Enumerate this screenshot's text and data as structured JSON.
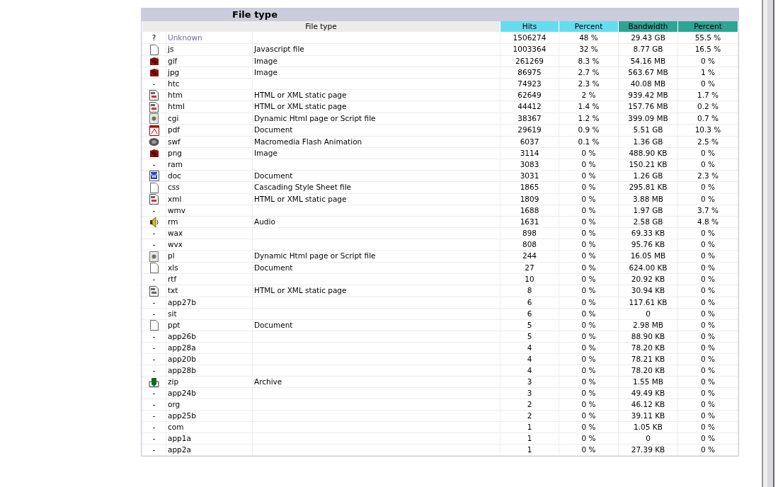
{
  "title": "File type",
  "table": {
    "columns": [
      {
        "label": "File type",
        "kind": "name"
      },
      {
        "label": "Hits",
        "kind": "hits"
      },
      {
        "label": "Percent",
        "kind": "hits"
      },
      {
        "label": "Bandwidth",
        "kind": "bandwidth"
      },
      {
        "label": "Percent",
        "kind": "bandwidth"
      }
    ],
    "rows": [
      {
        "kind": "unknown",
        "symbol": "?",
        "type": "Unknown",
        "hits": "1506274",
        "hits_pct": "48 %",
        "bandwidth": "29.43 GB",
        "bw_pct": "55.5 %"
      },
      {
        "kind": "page",
        "type": "js",
        "description": "Javascript file",
        "hits": "1003364",
        "hits_pct": "32 %",
        "bandwidth": "8.77 GB",
        "bw_pct": "16.5 %"
      },
      {
        "kind": "image",
        "type": "gif",
        "description": "Image",
        "hits": "261269",
        "hits_pct": "8.3 %",
        "bandwidth": "54.16 MB",
        "bw_pct": "0 %"
      },
      {
        "kind": "image",
        "type": "jpg",
        "description": "Image",
        "hits": "86975",
        "hits_pct": "2.7 %",
        "bandwidth": "563.67 MB",
        "bw_pct": "1 %"
      },
      {
        "kind": "none",
        "symbol": "-",
        "type": "htc",
        "hits": "74923",
        "hits_pct": "2.3 %",
        "bandwidth": "40.08 MB",
        "bw_pct": "0 %"
      },
      {
        "kind": "html",
        "type": "htm",
        "description": "HTML or XML static page",
        "hits": "62649",
        "hits_pct": "2 %",
        "bandwidth": "939.42 MB",
        "bw_pct": "1.7 %"
      },
      {
        "kind": "html",
        "type": "html",
        "description": "HTML or XML static page",
        "hits": "44412",
        "hits_pct": "1.4 %",
        "bandwidth": "157.76 MB",
        "bw_pct": "0.2 %"
      },
      {
        "kind": "script",
        "type": "cgi",
        "description": "Dynamic Html page or Script file",
        "hits": "38367",
        "hits_pct": "1.2 %",
        "bandwidth": "399.09 MB",
        "bw_pct": "0.7 %"
      },
      {
        "kind": "pdf",
        "type": "pdf",
        "description": "Document",
        "hits": "29619",
        "hits_pct": "0.9 %",
        "bandwidth": "5.51 GB",
        "bw_pct": "10.3 %"
      },
      {
        "kind": "flash",
        "type": "swf",
        "description": "Macromedia Flash Animation",
        "hits": "6037",
        "hits_pct": "0.1 %",
        "bandwidth": "1.36 GB",
        "bw_pct": "2.5 %"
      },
      {
        "kind": "image",
        "type": "png",
        "description": "Image",
        "hits": "3114",
        "hits_pct": "0 %",
        "bandwidth": "488.90 KB",
        "bw_pct": "0 %"
      },
      {
        "kind": "none",
        "symbol": "-",
        "type": "ram",
        "hits": "3083",
        "hits_pct": "0 %",
        "bandwidth": "150.21 KB",
        "bw_pct": "0 %"
      },
      {
        "kind": "word",
        "type": "doc",
        "description": "Document",
        "hits": "3031",
        "hits_pct": "0 %",
        "bandwidth": "1.26 GB",
        "bw_pct": "2.3 %"
      },
      {
        "kind": "page",
        "type": "css",
        "description": "Cascading Style Sheet file",
        "hits": "1865",
        "hits_pct": "0 %",
        "bandwidth": "295.81 KB",
        "bw_pct": "0 %"
      },
      {
        "kind": "html",
        "type": "xml",
        "description": "HTML or XML static page",
        "hits": "1809",
        "hits_pct": "0 %",
        "bandwidth": "3.88 MB",
        "bw_pct": "0 %"
      },
      {
        "kind": "none",
        "symbol": "-",
        "type": "wmv",
        "hits": "1688",
        "hits_pct": "0 %",
        "bandwidth": "1.97 GB",
        "bw_pct": "3.7 %"
      },
      {
        "kind": "audio",
        "type": "rm",
        "description": "Audio",
        "hits": "1631",
        "hits_pct": "0 %",
        "bandwidth": "2.58 GB",
        "bw_pct": "4.8 %"
      },
      {
        "kind": "none",
        "symbol": "-",
        "type": "wax",
        "hits": "898",
        "hits_pct": "0 %",
        "bandwidth": "69.33 KB",
        "bw_pct": "0 %"
      },
      {
        "kind": "none",
        "symbol": "-",
        "type": "wvx",
        "hits": "808",
        "hits_pct": "0 %",
        "bandwidth": "95.76 KB",
        "bw_pct": "0 %"
      },
      {
        "kind": "script",
        "type": "pl",
        "description": "Dynamic Html page or Script file",
        "hits": "244",
        "hits_pct": "0 %",
        "bandwidth": "16.05 MB",
        "bw_pct": "0 %"
      },
      {
        "kind": "page",
        "type": "xls",
        "description": "Document",
        "hits": "27",
        "hits_pct": "0 %",
        "bandwidth": "624.00 KB",
        "bw_pct": "0 %"
      },
      {
        "kind": "none",
        "symbol": "-",
        "type": "rtf",
        "hits": "10",
        "hits_pct": "0 %",
        "bandwidth": "20.92 KB",
        "bw_pct": "0 %"
      },
      {
        "kind": "text",
        "type": "txt",
        "description": "HTML or XML static page",
        "hits": "8",
        "hits_pct": "0 %",
        "bandwidth": "30.94 KB",
        "bw_pct": "0 %"
      },
      {
        "kind": "none",
        "symbol": "-",
        "type": "app27b",
        "hits": "6",
        "hits_pct": "0 %",
        "bandwidth": "117.61 KB",
        "bw_pct": "0 %"
      },
      {
        "kind": "none",
        "symbol": "-",
        "type": "sit",
        "hits": "6",
        "hits_pct": "0 %",
        "bandwidth": "0",
        "bw_pct": "0 %"
      },
      {
        "kind": "page",
        "type": "ppt",
        "description": "Document",
        "hits": "5",
        "hits_pct": "0 %",
        "bandwidth": "2.98 MB",
        "bw_pct": "0 %"
      },
      {
        "kind": "none",
        "symbol": "-",
        "type": "app26b",
        "hits": "5",
        "hits_pct": "0 %",
        "bandwidth": "88.90 KB",
        "bw_pct": "0 %"
      },
      {
        "kind": "none",
        "symbol": "-",
        "type": "app28a",
        "hits": "4",
        "hits_pct": "0 %",
        "bandwidth": "78.20 KB",
        "bw_pct": "0 %"
      },
      {
        "kind": "none",
        "symbol": "-",
        "type": "app20b",
        "hits": "4",
        "hits_pct": "0 %",
        "bandwidth": "78.21 KB",
        "bw_pct": "0 %"
      },
      {
        "kind": "none",
        "symbol": "-",
        "type": "app28b",
        "hits": "4",
        "hits_pct": "0 %",
        "bandwidth": "78.20 KB",
        "bw_pct": "0 %"
      },
      {
        "kind": "archive",
        "type": "zip",
        "description": "Archive",
        "hits": "3",
        "hits_pct": "0 %",
        "bandwidth": "1.55 MB",
        "bw_pct": "0 %"
      },
      {
        "kind": "none",
        "symbol": "-",
        "type": "app24b",
        "hits": "3",
        "hits_pct": "0 %",
        "bandwidth": "49.49 KB",
        "bw_pct": "0 %"
      },
      {
        "kind": "none",
        "symbol": "-",
        "type": "org",
        "hits": "2",
        "hits_pct": "0 %",
        "bandwidth": "46.12 KB",
        "bw_pct": "0 %"
      },
      {
        "kind": "none",
        "symbol": "-",
        "type": "app25b",
        "hits": "2",
        "hits_pct": "0 %",
        "bandwidth": "39.11 KB",
        "bw_pct": "0 %"
      },
      {
        "kind": "none",
        "symbol": "-",
        "type": "com",
        "hits": "1",
        "hits_pct": "0 %",
        "bandwidth": "1.05 KB",
        "bw_pct": "0 %"
      },
      {
        "kind": "none",
        "symbol": "-",
        "type": "app1a",
        "hits": "1",
        "hits_pct": "0 %",
        "bandwidth": "0",
        "bw_pct": "0 %"
      },
      {
        "kind": "none",
        "symbol": "-",
        "type": "app2a",
        "hits": "1",
        "hits_pct": "0 %",
        "bandwidth": "27.39 KB",
        "bw_pct": "0 %"
      }
    ]
  }
}
